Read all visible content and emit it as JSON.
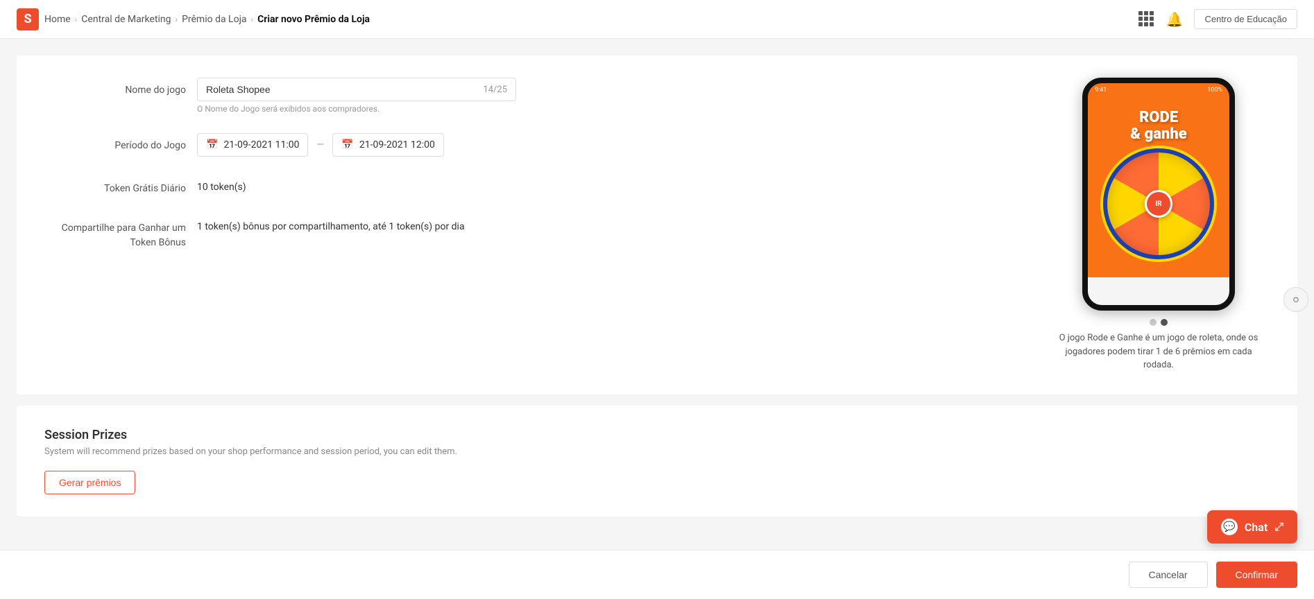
{
  "header": {
    "logo": "S",
    "breadcrumbs": [
      {
        "label": "Home",
        "active": false
      },
      {
        "label": "Central de Marketing",
        "active": false
      },
      {
        "label": "Prêmio da Loja",
        "active": false
      },
      {
        "label": "Criar novo Prêmio da Loja",
        "active": true
      }
    ],
    "edu_button": "Centro de Educação"
  },
  "form": {
    "game_name_label": "Nome do jogo",
    "game_name_value": "Roleta Shopee",
    "game_name_char_count": "14/25",
    "game_name_hint": "O Nome do Jogo será exibidos aos compradores.",
    "period_label": "Período do Jogo",
    "period_start": "21-09-2021 11:00",
    "period_end": "21-09-2021 12:00",
    "token_label": "Token Grátis Diário",
    "token_value": "10 token(s)",
    "share_label": "Compartilhe para Ganhar um Token Bônus",
    "share_value": "1 token(s) bônus por compartilhamento, até 1 token(s) por dia"
  },
  "preview": {
    "phone_title_line1": "RODE",
    "phone_title_line2": "& ganhe",
    "wheel_center_label": "IR",
    "dot_active_index": 1,
    "description": "O jogo Rode e Ganhe é um jogo de roleta, onde os jogadores podem tirar 1 de 6 prêmios em cada rodada."
  },
  "session_prizes": {
    "title": "Session Prizes",
    "subtitle": "System will recommend prizes based on your shop performance and session period, you can edit them.",
    "gerar_button": "Gerar prêmios"
  },
  "footer": {
    "cancel_label": "Cancelar",
    "confirm_label": "Confirmar"
  },
  "chat": {
    "label": "Chat",
    "icon": "💬"
  }
}
